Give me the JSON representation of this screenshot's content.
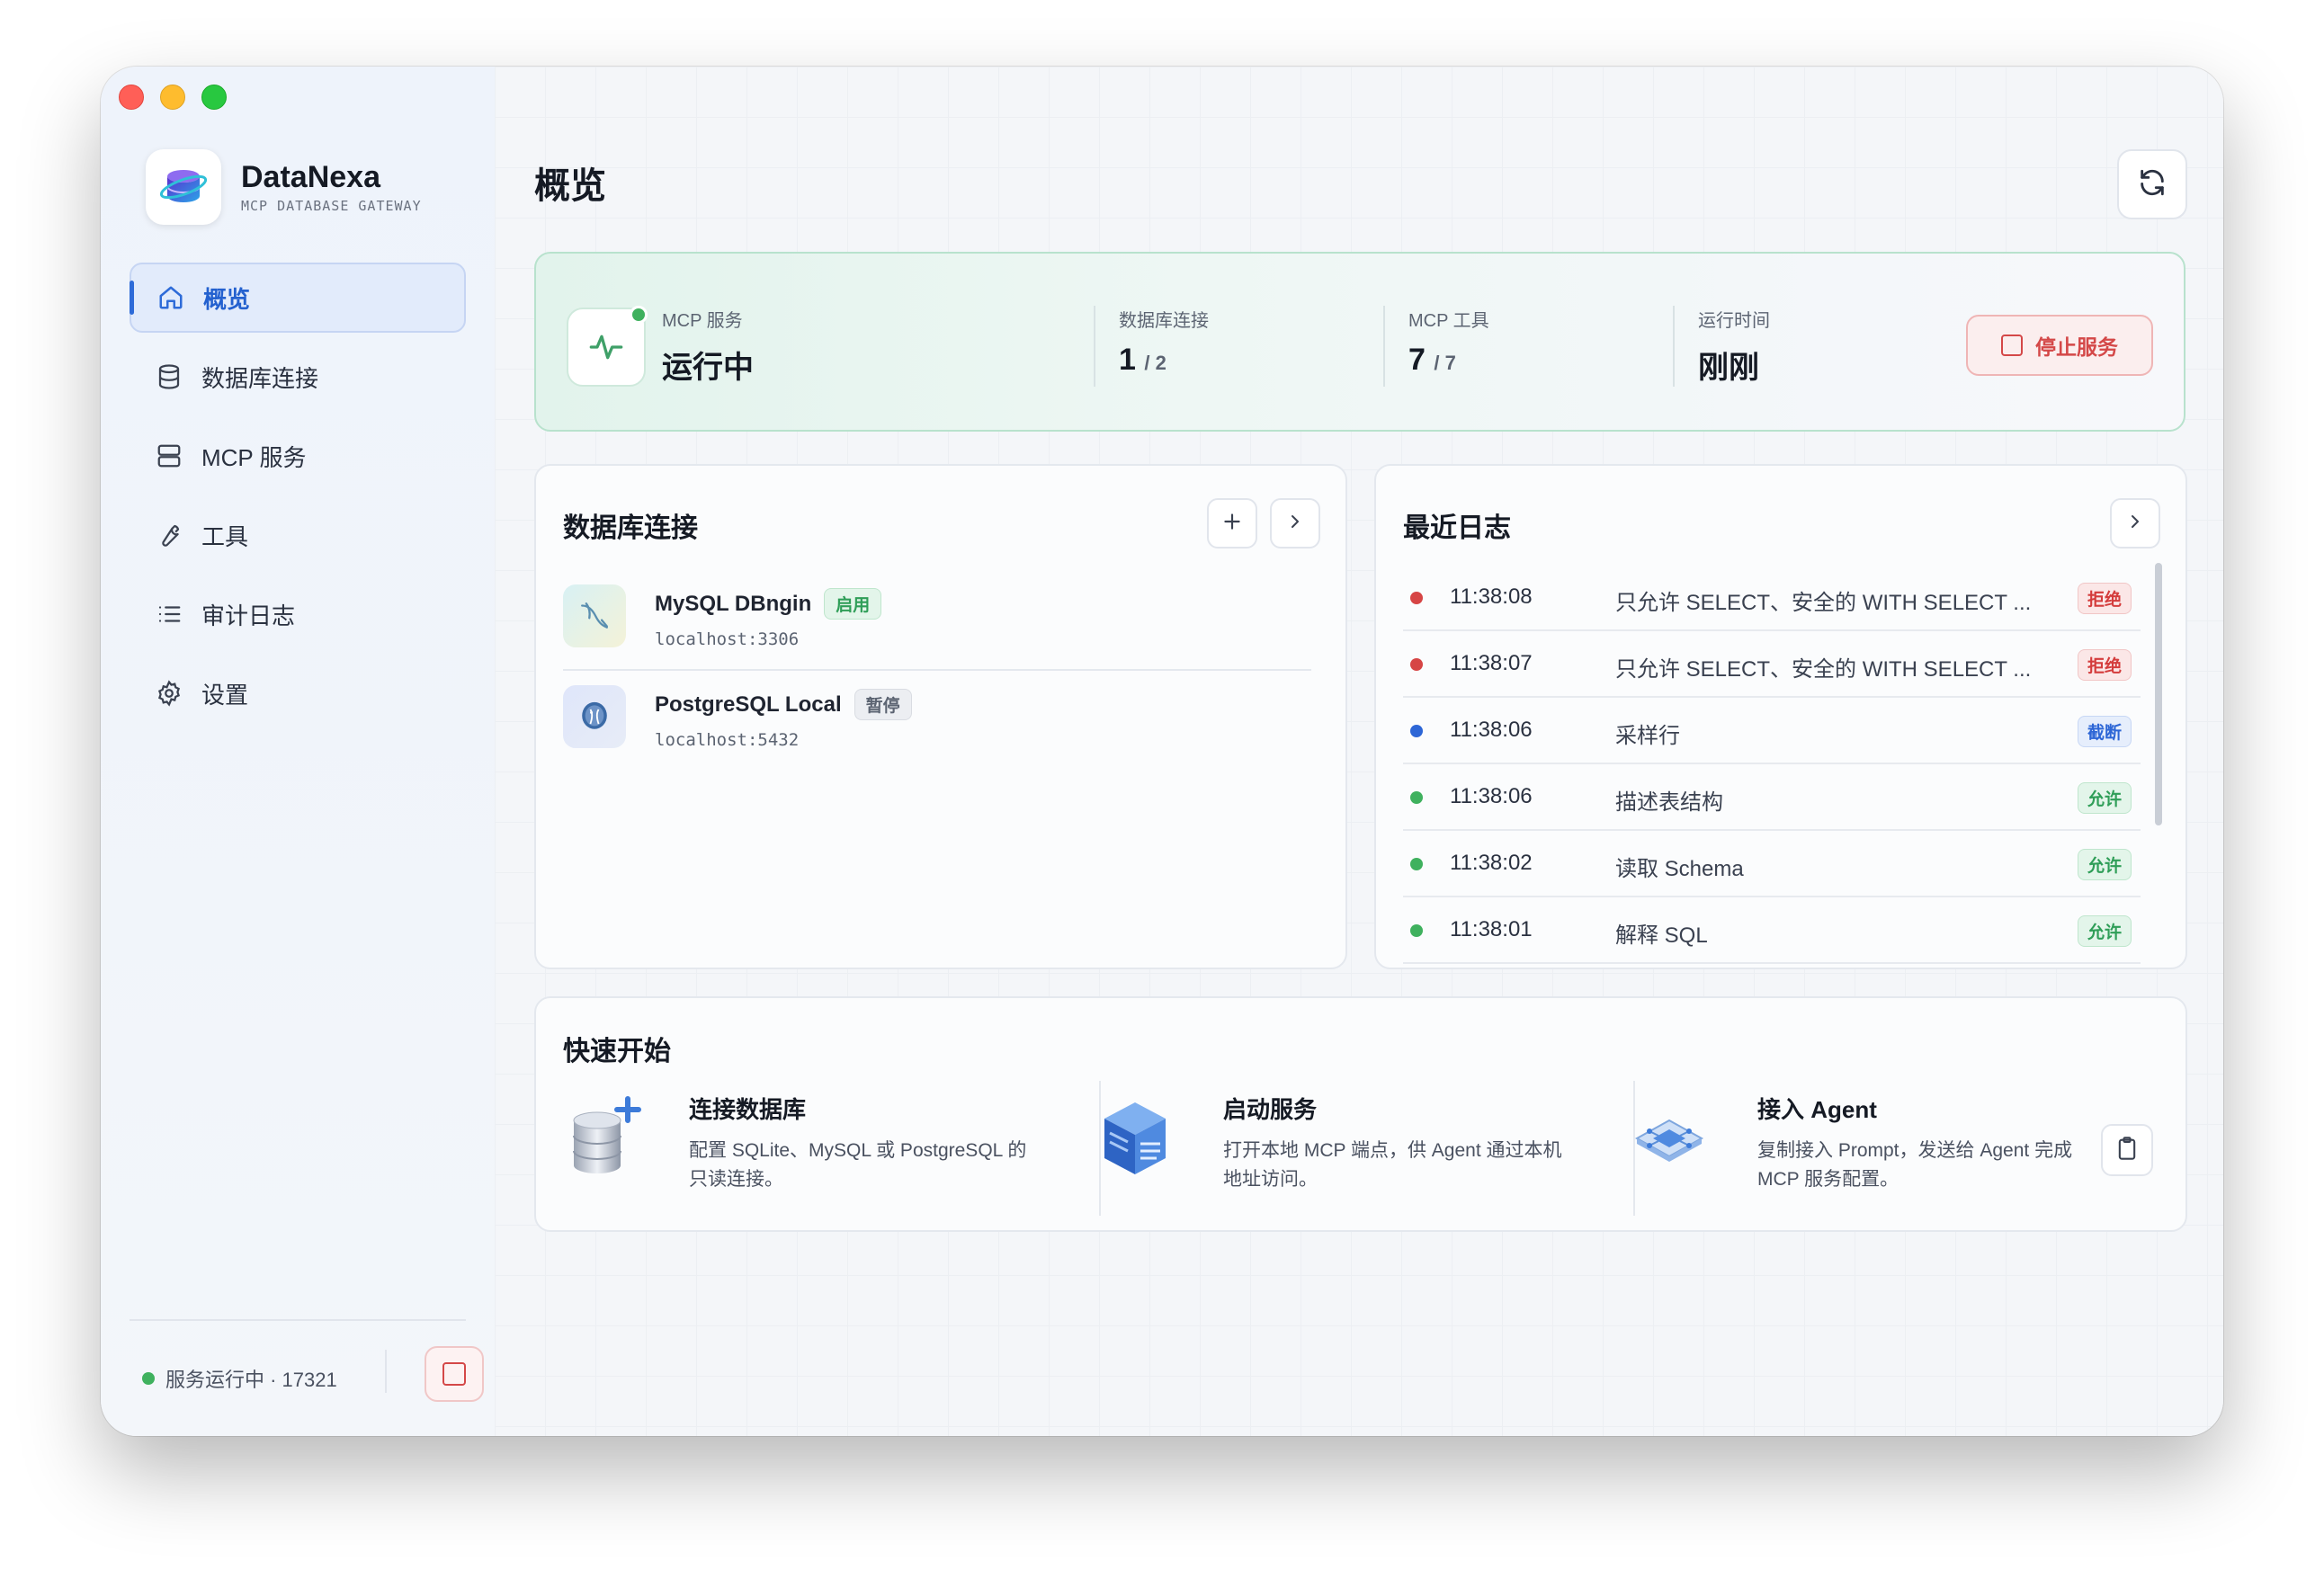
{
  "brand": {
    "name": "DataNexa",
    "subtitle": "MCP DATABASE GATEWAY"
  },
  "sidebar": {
    "items": [
      {
        "label": "概览",
        "icon": "home-icon",
        "active": true
      },
      {
        "label": "数据库连接",
        "icon": "database-icon",
        "active": false
      },
      {
        "label": "MCP 服务",
        "icon": "server-icon",
        "active": false
      },
      {
        "label": "工具",
        "icon": "wrench-icon",
        "active": false
      },
      {
        "label": "审计日志",
        "icon": "list-icon",
        "active": false
      },
      {
        "label": "设置",
        "icon": "gear-icon",
        "active": false
      }
    ],
    "footer_status": "服务运行中 · 17321"
  },
  "header": {
    "title": "概览"
  },
  "status_card": {
    "service_label": "MCP 服务",
    "service_value": "运行中",
    "db_label": "数据库连接",
    "db_value": "1",
    "db_total": "/ 2",
    "tools_label": "MCP 工具",
    "tools_value": "7",
    "tools_total": "/ 7",
    "uptime_label": "运行时间",
    "uptime_value": "刚刚",
    "stop_label": "停止服务"
  },
  "db_card": {
    "title": "数据库连接",
    "items": [
      {
        "name": "MySQL DBngin",
        "badge": "启用",
        "host": "localhost:3306"
      },
      {
        "name": "PostgreSQL Local",
        "badge": "暂停",
        "host": "localhost:5432"
      }
    ]
  },
  "log_card": {
    "title": "最近日志",
    "rows": [
      {
        "time": "11:38:08",
        "message": "只允许 SELECT、安全的 WITH SELECT ...",
        "badge": "拒绝",
        "status": "deny"
      },
      {
        "time": "11:38:07",
        "message": "只允许 SELECT、安全的 WITH SELECT ...",
        "badge": "拒绝",
        "status": "deny"
      },
      {
        "time": "11:38:06",
        "message": "采样行",
        "badge": "截断",
        "status": "truncate"
      },
      {
        "time": "11:38:06",
        "message": "描述表结构",
        "badge": "允许",
        "status": "allow"
      },
      {
        "time": "11:38:02",
        "message": "读取 Schema",
        "badge": "允许",
        "status": "allow"
      },
      {
        "time": "11:38:01",
        "message": "解释 SQL",
        "badge": "允许",
        "status": "allow"
      }
    ]
  },
  "quick_start": {
    "title": "快速开始",
    "items": [
      {
        "title": "连接数据库",
        "desc": "配置 SQLite、MySQL 或 PostgreSQL 的只读连接。"
      },
      {
        "title": "启动服务",
        "desc": "打开本地 MCP 端点，供 Agent 通过本机地址访问。"
      },
      {
        "title": "接入 Agent",
        "desc": "复制接入 Prompt，发送给 Agent 完成 MCP 服务配置。"
      }
    ]
  },
  "colors": {
    "accent": "#2e6bd8",
    "success": "#3fb15e",
    "danger": "#d44848",
    "info": "#2d66d6"
  }
}
